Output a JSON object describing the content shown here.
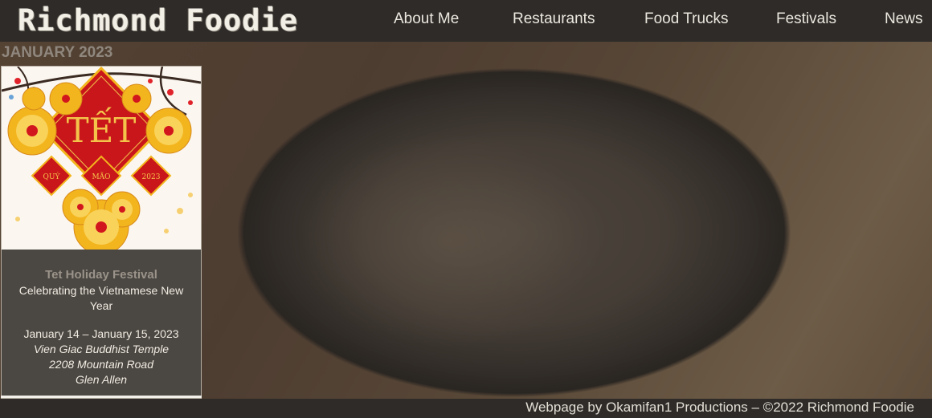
{
  "site": {
    "logo_text": "Richmond Foodie"
  },
  "nav": {
    "items": [
      {
        "label": "About Me"
      },
      {
        "label": "Restaurants"
      },
      {
        "label": "Food Trucks"
      },
      {
        "label": "Festivals"
      },
      {
        "label": "News"
      }
    ]
  },
  "main": {
    "month_heading": "JANUARY 2023",
    "event": {
      "poster": {
        "title": "TẾT",
        "year_left": "QUÝ",
        "year_mid": "MÃO",
        "year_right": "2023"
      },
      "title": "Tet Holiday Festival",
      "subtitle": "Celebrating the Vietnamese New Year",
      "dates": "January 14 – January 15, 2023",
      "venue": "Vien Giac Buddhist Temple",
      "address": "2208 Mountain Road",
      "city": "Glen Allen"
    }
  },
  "footer": {
    "text": "Webpage by Okamifan1 Productions – ©2022 Richmond Foodie"
  },
  "colors": {
    "header_bg": "#2e2b29",
    "poster_red": "#c9161b",
    "poster_gold": "#f3b51d"
  }
}
